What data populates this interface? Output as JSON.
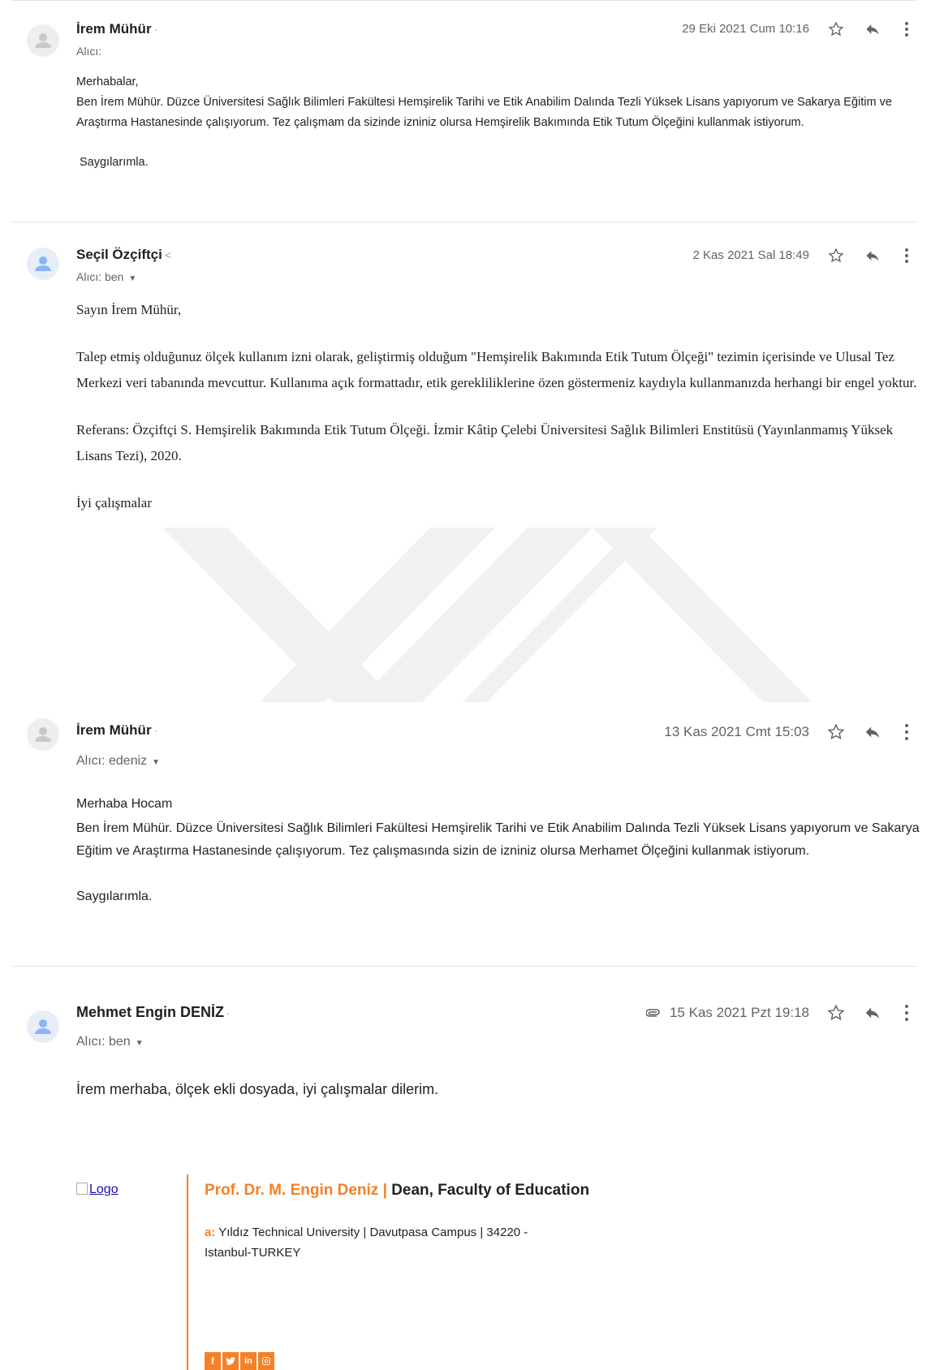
{
  "emails": [
    {
      "sender": "İrem Mühür",
      "sender_suffix": "·",
      "recipient": "Alıcı:",
      "date": "29 Eki 2021 Cum 10:16",
      "body": [
        "Merhabalar,",
        "Ben İrem Mühür. Düzce Üniversitesi Sağlık Bilimleri Fakültesi Hemşirelik Tarihi ve Etik Anabilim Dalında Tezli Yüksek Lisans yapıyorum ve Sakarya Eğitim ve Araştırma Hastanesinde çalışıyorum. Tez çalışmam da sizinde izniniz olursa  Hemşirelik Bakımında Etik Tutum Ölçeğini kullanmak istiyorum.",
        "Saygılarımla."
      ]
    },
    {
      "sender": "Seçil Özçiftçi",
      "sender_suffix": "<",
      "recipient": "Alıcı: ben",
      "date": "2 Kas 2021 Sal 18:49",
      "body": [
        "Sayın İrem Mühür,",
        "Talep etmiş olduğunuz ölçek kullanım izni olarak, geliştirmiş olduğum \"Hemşirelik Bakımında Etik Tutum Ölçeği\" tezimin içerisinde ve Ulusal Tez Merkezi veri tabanında mevcuttur. Kullanıma açık formattadır, etik gerekliliklerine özen göstermeniz kaydıyla kullanmanızda herhangi bir engel yoktur.",
        "Referans: Özçiftçi S. Hemşirelik Bakımında Etik Tutum Ölçeği. İzmir Kâtip Çelebi Üniversitesi Sağlık Bilimleri Enstitüsü (Yayınlanmamış Yüksek Lisans Tezi), 2020.",
        "İyi çalışmalar"
      ]
    },
    {
      "sender": "İrem Mühür",
      "sender_suffix": "·",
      "recipient": "Alıcı: edeniz",
      "date": "13 Kas 2021 Cmt 15:03",
      "body": [
        "Merhaba Hocam",
        "Ben İrem Mühür. Düzce Üniversitesi Sağlık Bilimleri Fakültesi Hemşirelik Tarihi ve Etik Anabilim Dalında Tezli Yüksek Lisans yapıyorum ve Sakarya Eğitim ve Araştırma Hastanesinde çalışıyorum. Tez çalışmasında sizin de izniniz olursa Merhamet Ölçeğini kullanmak istiyorum.",
        "Saygılarımla."
      ]
    },
    {
      "sender": "Mehmet Engin DENİZ",
      "sender_suffix": "·",
      "recipient": "Alıcı: ben",
      "date": "15 Kas 2021 Pzt 19:18",
      "has_attachment": true,
      "body": [
        "İrem merhaba, ölçek ekli dosyada, iyi çalışmalar dilerim."
      ]
    }
  ],
  "signature": {
    "logo_alt": "Logo",
    "name": "Prof. Dr. M. Engin Deniz",
    "separator": "|",
    "title": "Dean, Faculty of Education",
    "addr_label": "a:",
    "address": "Yıldız Technical University | Davutpasa Campus | 34220 - Istanbul-TURKEY",
    "social": [
      "f",
      "t",
      "in",
      "ig"
    ]
  },
  "icons": {
    "star": "star-outline-icon",
    "reply": "reply-icon",
    "more": "more-vert-icon",
    "attachment": "attachment-clip-icon",
    "avatar": "default-avatar-icon"
  },
  "colors": {
    "accent_orange": "#f58025",
    "text_gray": "#5f6368"
  }
}
